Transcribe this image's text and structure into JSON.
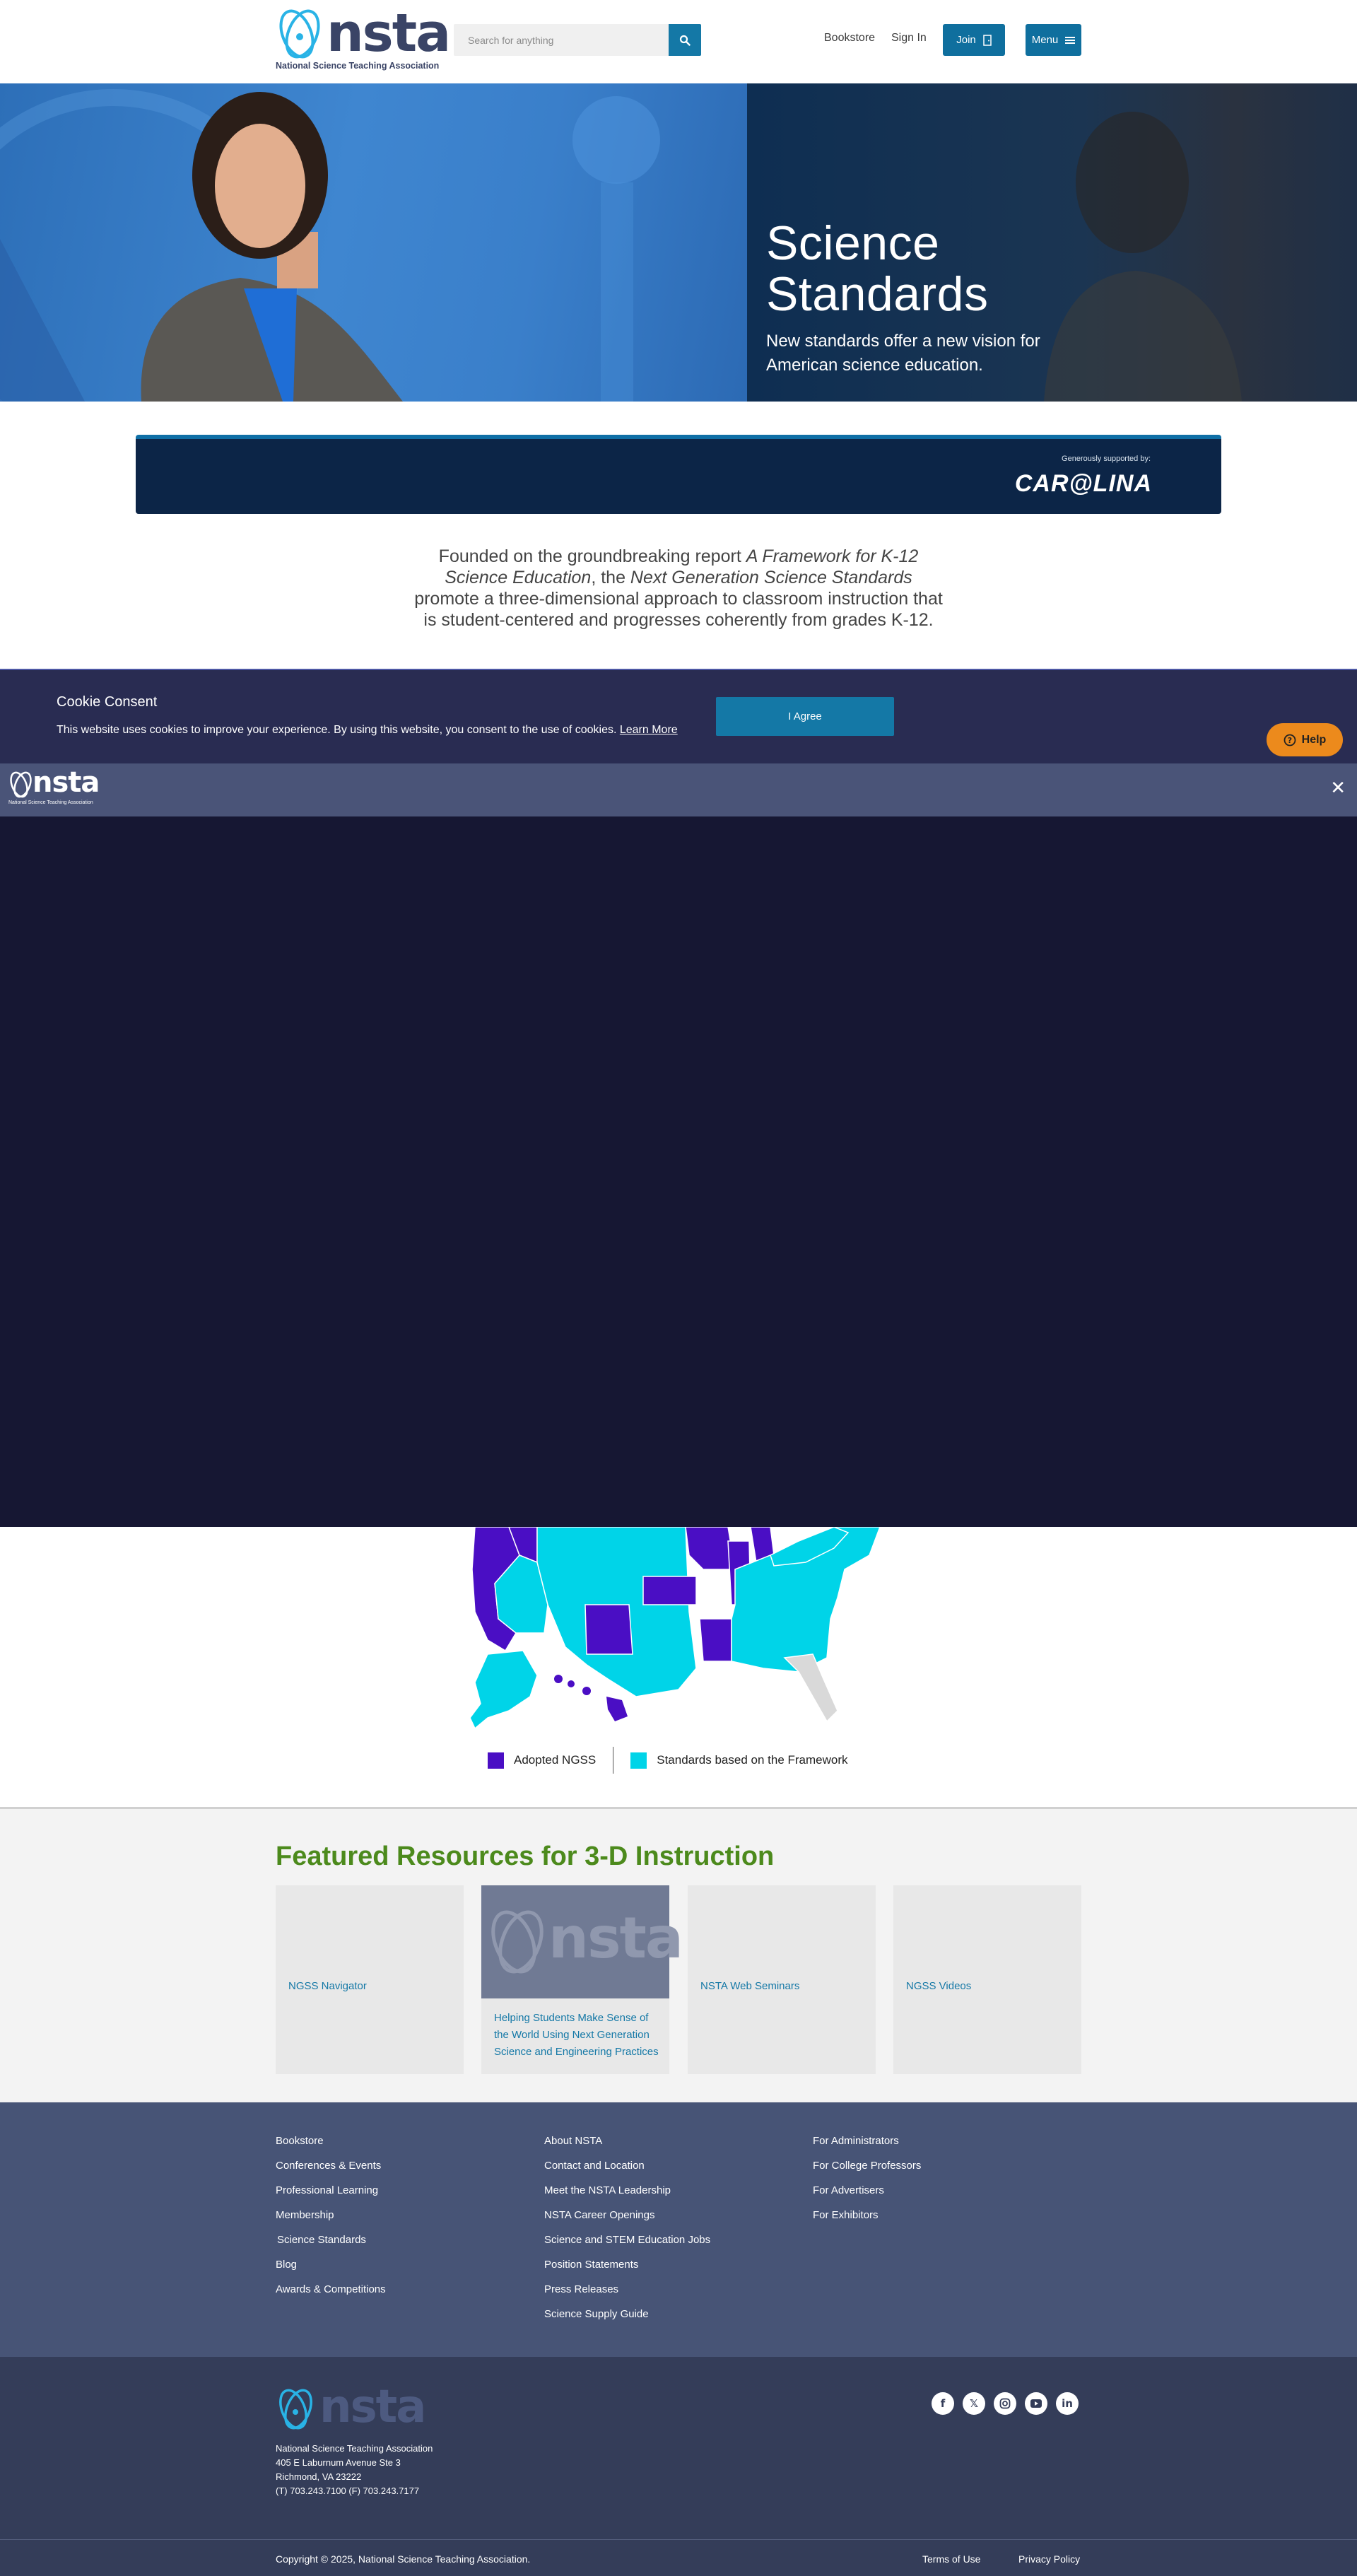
{
  "header": {
    "logo_word": "nsta",
    "logo_tagline": "National Science Teaching Association",
    "search_placeholder": "Search for anything",
    "bookstore": "Bookstore",
    "sign_in": "Sign In",
    "join": "Join",
    "menu": "Menu"
  },
  "hero": {
    "title_line1": "Science",
    "title_line2": "Standards",
    "subtitle": "New standards offer a new vision for American science education."
  },
  "sponsor": {
    "label": "Generously supported by:",
    "name": "CAR@LINA"
  },
  "intro": {
    "part1": "Founded on the groundbreaking report ",
    "italic1": "A Framework for K-12 Science Education",
    "part2": ", the ",
    "italic2": "Next Generation Science Standards",
    "part3": " promote a three-dimensional approach to classroom instruction that is student-centered and progresses coherently from grades K-12."
  },
  "cookie": {
    "title": "Cookie Consent",
    "text": "This website uses cookies to improve your experience. By using this website, you consent to the use of cookies.",
    "link": "Learn More",
    "agree": "I Agree"
  },
  "help": "Help",
  "modal": {
    "logo_word": "nsta",
    "logo_tagline": "National Science Teaching Association",
    "close": "✕"
  },
  "map": {
    "legend_adopted": "Adopted NGSS",
    "legend_framework": "Standards based on the Framework",
    "colors": {
      "adopted": "#4a0ec4",
      "framework": "#00d4e8",
      "none": "#d9d9d9"
    }
  },
  "featured": {
    "title": "Featured Resources for 3-D Instruction",
    "cards": [
      {
        "label": "NGSS Navigator"
      },
      {
        "label": "Helping Students Make Sense of the World Using Next Generation Science and Engineering Practices",
        "lines": [
          "Helping Students Make Sense of",
          "the World Using Next Generation",
          "Science and Engineering Practices"
        ],
        "image_word": "nsta"
      },
      {
        "label": "NSTA Web Seminars"
      },
      {
        "label": "NGSS Videos"
      }
    ]
  },
  "footer": {
    "col1": [
      "Bookstore",
      "Conferences & Events",
      "Professional Learning",
      "Membership",
      "Science Standards",
      "Blog",
      "Awards & Competitions"
    ],
    "col2": [
      "About NSTA",
      "Contact and Location",
      "Meet the NSTA Leadership",
      "NSTA Career Openings",
      "Science and STEM Education Jobs",
      "Position Statements",
      "Press Releases",
      "Science Supply Guide"
    ],
    "col3": [
      "For Administrators",
      "For College Professors",
      "For Advertisers",
      "For Exhibitors"
    ],
    "logo_word": "nsta",
    "address": [
      "National Science Teaching Association",
      "405 E Laburnum Avenue Ste 3",
      "Richmond, VA 23222",
      "(T) 703.243.7100 (F) 703.243.7177"
    ],
    "social": [
      "facebook-icon",
      "x-icon",
      "instagram-icon",
      "youtube-icon",
      "linkedin-icon"
    ],
    "copyright": "Copyright © 2025, National Science Teaching Association.",
    "terms": "Terms of Use",
    "privacy": "Privacy Policy"
  }
}
